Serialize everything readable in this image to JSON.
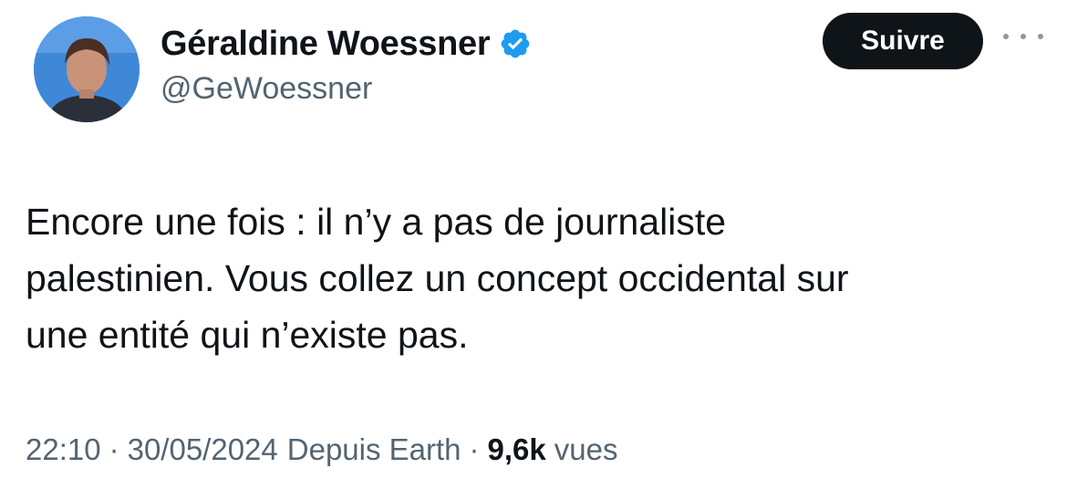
{
  "author": {
    "display_name": "Géraldine Woessner",
    "handle": "@GeWoessner",
    "verified": true,
    "verified_color": "#1d9bf0"
  },
  "actions": {
    "follow_label": "Suivre"
  },
  "tweet": {
    "lines": [
      "Encore une fois : il n’y a pas de journaliste",
      "palestinien. Vous collez un concept occidental sur",
      "une entité qui n’existe pas."
    ]
  },
  "meta": {
    "time": "22:10",
    "separator": "·",
    "date": "30/05/2024",
    "source": "Depuis Earth",
    "views_count": "9,6k",
    "views_label": "vues"
  }
}
